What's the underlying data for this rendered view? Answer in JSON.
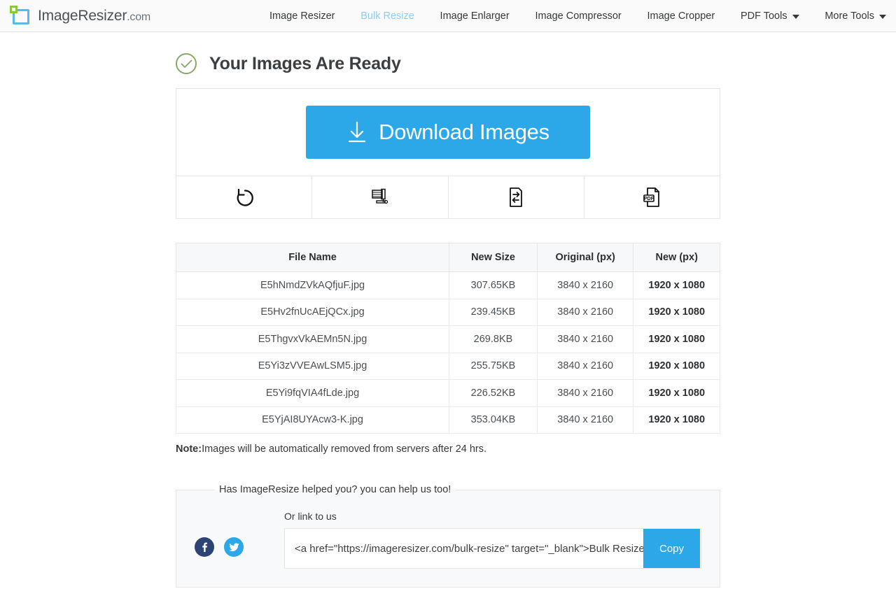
{
  "header": {
    "brand_name": "ImageResizer",
    "brand_suffix": ".com",
    "logo_icon": "resize-square-logo",
    "nav": [
      {
        "label": "Image Resizer",
        "active": false,
        "caret": false
      },
      {
        "label": "Bulk Resize",
        "active": true,
        "caret": false
      },
      {
        "label": "Image Enlarger",
        "active": false,
        "caret": false
      },
      {
        "label": "Image Compressor",
        "active": false,
        "caret": false
      },
      {
        "label": "Image Cropper",
        "active": false,
        "caret": false
      },
      {
        "label": "PDF Tools",
        "active": false,
        "caret": true
      },
      {
        "label": "More Tools",
        "active": false,
        "caret": true
      }
    ]
  },
  "main": {
    "page_title": "Your Images Are Ready",
    "status_icon": "check-circle-icon",
    "download_button_label": "Download Images",
    "download_icon": "download-arrow-icon",
    "actions": [
      {
        "name": "start-over",
        "icon": "undo-arrow-icon"
      },
      {
        "name": "compress",
        "icon": "compress-clamp-icon"
      },
      {
        "name": "convert",
        "icon": "convert-document-icon"
      },
      {
        "name": "to-pdf",
        "icon": "pdf-document-icon"
      }
    ],
    "table": {
      "columns": [
        "File Name",
        "New Size",
        "Original (px)",
        "New (px)"
      ],
      "rows": [
        {
          "file_name": "E5hNmdZVkAQfjuF.jpg",
          "new_size": "307.65KB",
          "original_px": "3840 x 2160",
          "new_px": "1920 x 1080"
        },
        {
          "file_name": "E5Hv2fnUcAEjQCx.jpg",
          "new_size": "239.45KB",
          "original_px": "3840 x 2160",
          "new_px": "1920 x 1080"
        },
        {
          "file_name": "E5ThgvxVkAEMn5N.jpg",
          "new_size": "269.8KB",
          "original_px": "3840 x 2160",
          "new_px": "1920 x 1080"
        },
        {
          "file_name": "E5Yi3zVVEAwLSM5.jpg",
          "new_size": "255.75KB",
          "original_px": "3840 x 2160",
          "new_px": "1920 x 1080"
        },
        {
          "file_name": "E5Yi9fqVIA4fLde.jpg",
          "new_size": "226.52KB",
          "original_px": "3840 x 2160",
          "new_px": "1920 x 1080"
        },
        {
          "file_name": "E5YjAI8UYAcw3-K.jpg",
          "new_size": "353.04KB",
          "original_px": "3840 x 2160",
          "new_px": "1920 x 1080"
        }
      ]
    },
    "note_label": "Note:",
    "note_text": "Images will be automatically removed from servers after 24 hrs."
  },
  "share": {
    "legend": "Has ImageResize helped you? you can help us too!",
    "link_label": "Or link to us",
    "link_value": "<a href=\"https://imageresizer.com/bulk-resize\" target=\"_blank\">Bulk Resize</a>",
    "copy_label": "Copy",
    "facebook_icon": "facebook-icon",
    "twitter_icon": "twitter-icon"
  },
  "colors": {
    "accent": "#2ca8e8",
    "active_nav": "#8dcdf0",
    "check_green": "#8aa86a",
    "logo_blue": "#5bb9e8",
    "logo_green": "#8cc63f",
    "facebook": "#2d4373",
    "twitter": "#2ca8e8",
    "panel_border": "#e4e6e8",
    "table_header_bg": "#f6f8f9",
    "share_bg": "#f7f9fa"
  }
}
